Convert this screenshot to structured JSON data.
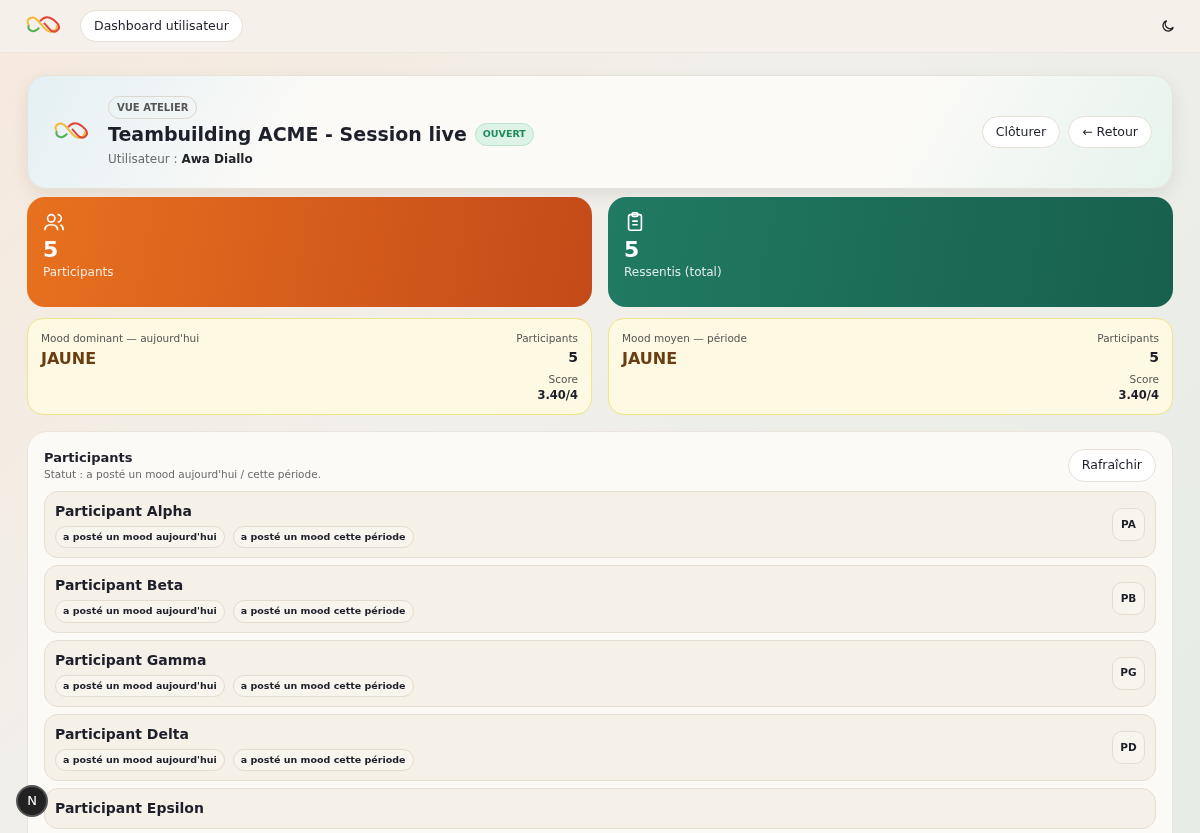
{
  "navbar": {
    "nav_button": "Dashboard utilisateur"
  },
  "header": {
    "eyebrow": "VUE ATELIER",
    "title": "Teambuilding ACME - Session live",
    "status": "OUVERT",
    "user_label": "Utilisateur :",
    "user_name": "Awa Diallo",
    "buttons": [
      "Clôturer",
      "← Retour"
    ]
  },
  "stats": [
    {
      "kind": "people",
      "value": "5",
      "label": "Participants"
    },
    {
      "kind": "clipboard",
      "value": "5",
      "label": "Ressentis (total)"
    }
  ],
  "moods": [
    {
      "caption": "Mood dominant — aujourd'hui",
      "mood": "JAUNE",
      "color": "#fdf9e3",
      "participants_label": "Participants",
      "participants": "5",
      "score_label": "Score",
      "score": "3.40/4"
    },
    {
      "caption": "Mood moyen — période",
      "mood": "JAUNE",
      "color": "#fdf9e3",
      "participants_label": "Participants",
      "participants": "5",
      "score_label": "Score",
      "score": "3.40/4"
    }
  ],
  "participants": {
    "title": "Participants",
    "subtitle": "Statut : a posté un mood aujourd'hui / cette période.",
    "refresh": "Rafraîchir",
    "rows": [
      {
        "name": "Participant Alpha",
        "tags": [
          "a posté un mood aujourd'hui",
          "a posté un mood cette période"
        ],
        "initials": "PA"
      },
      {
        "name": "Participant Beta",
        "tags": [
          "a posté un mood aujourd'hui",
          "a posté un mood cette période"
        ],
        "initials": "PB"
      },
      {
        "name": "Participant Gamma",
        "tags": [
          "a posté un mood aujourd'hui",
          "a posté un mood cette période"
        ],
        "initials": "PG"
      },
      {
        "name": "Participant Delta",
        "tags": [
          "a posté un mood aujourd'hui",
          "a posté un mood cette période"
        ],
        "initials": "PD"
      },
      {
        "name": "Participant Epsilon"
      }
    ]
  },
  "dev_badge": "N"
}
